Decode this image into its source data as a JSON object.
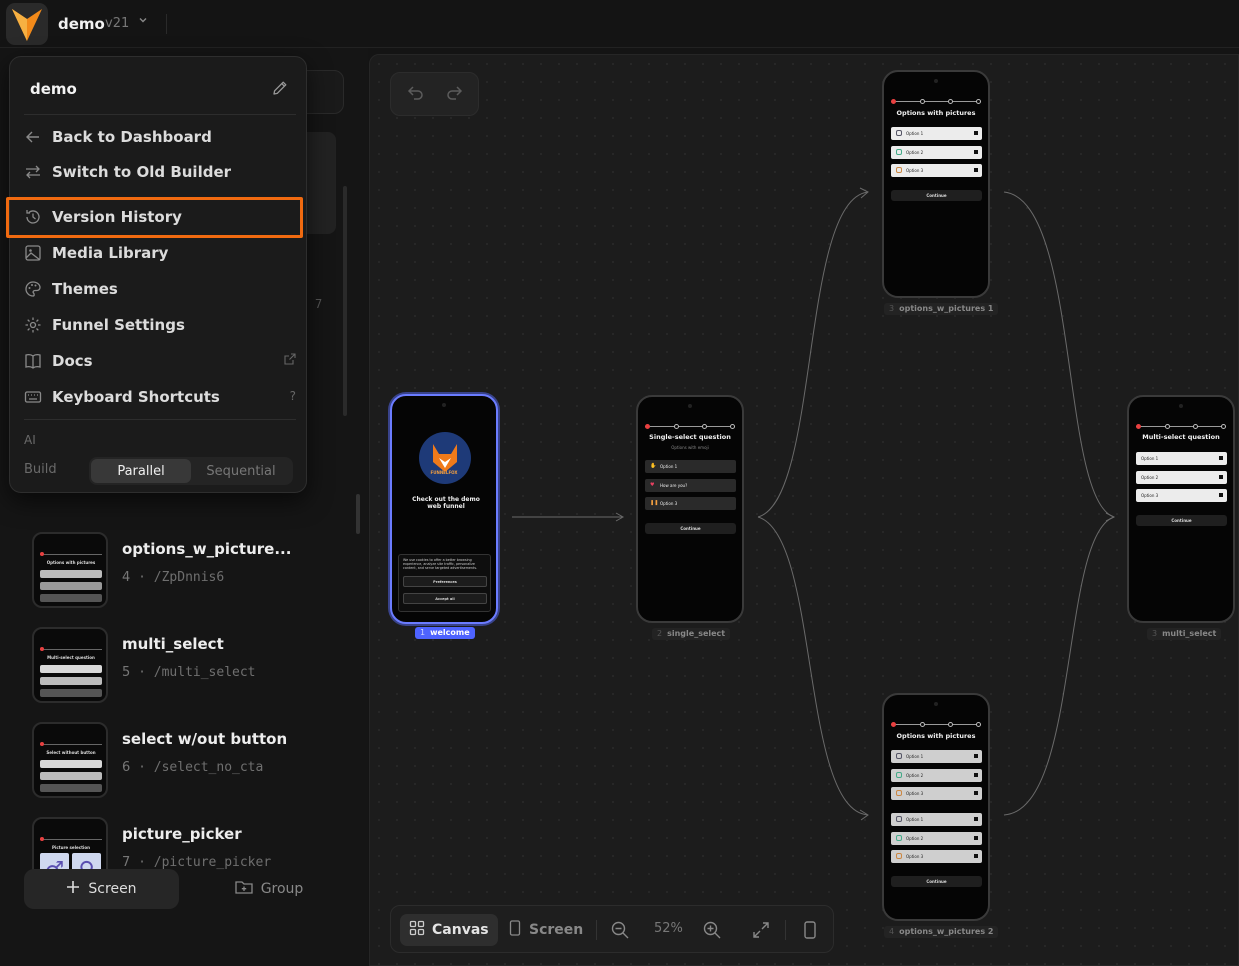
{
  "app": {
    "project_name": "demo",
    "version": "v21",
    "accent": "#f06a10",
    "selection_color": "#4e63ff"
  },
  "menu": {
    "title": "demo",
    "items": [
      {
        "label": "Back to Dashboard",
        "icon": "arrow-left-icon"
      },
      {
        "label": "Switch to Old Builder",
        "icon": "swap-icon"
      },
      {
        "label": "Version History",
        "icon": "history-icon"
      },
      {
        "label": "Media Library",
        "icon": "image-icon"
      },
      {
        "label": "Themes",
        "icon": "palette-icon"
      },
      {
        "label": "Funnel Settings",
        "icon": "gear-icon"
      },
      {
        "label": "Docs",
        "icon": "book-icon"
      },
      {
        "label": "Keyboard Shortcuts",
        "icon": "keyboard-icon",
        "shortcut": "?"
      }
    ],
    "ai_label": "AI",
    "build_label": "Build",
    "build_options": [
      "Parallel",
      "Sequential"
    ],
    "build_selected": "Parallel"
  },
  "sidebar": {
    "hidden_number": "7",
    "screens": [
      {
        "name": "options_w_picture...",
        "number": "4",
        "path": "/ZpDnnis6",
        "thumb_title": "Options with pictures"
      },
      {
        "name": "multi_select",
        "number": "5",
        "path": "/multi_select",
        "thumb_title": "Multi-select question"
      },
      {
        "name": "select w/out button",
        "number": "6",
        "path": "/select_no_cta",
        "thumb_title": "Select without button"
      },
      {
        "name": "picture_picker",
        "number": "7",
        "path": "/picture_picker",
        "thumb_title": "Picture selection"
      }
    ],
    "add_screen_label": "Screen",
    "add_group_label": "Group"
  },
  "canvas": {
    "nodes": [
      {
        "id": "welcome",
        "number": "1",
        "label": "welcome",
        "title": "Check out the demo web funnel",
        "brand": "FUNNELFOX",
        "cookie_text": "We use cookies to offer a better browsing experience, analyze site traffic, personalize content, and serve targeted advertisements.",
        "btn1": "Preferences",
        "btn2": "Accept all"
      },
      {
        "id": "single_select",
        "number": "2",
        "label": "single_select",
        "title": "Single-select question",
        "subtitle": "Options with emoji",
        "options": [
          "Option 1",
          "How are you?",
          "Option 3"
        ],
        "button": "Continue"
      },
      {
        "id": "options_w_pictures_1",
        "number": "3",
        "label": "options_w_pictures 1",
        "title": "Options with pictures",
        "options": [
          "Option 1",
          "Option 2",
          "Option 3"
        ],
        "button": "Continue"
      },
      {
        "id": "multi_select",
        "number": "3",
        "label": "multi_select",
        "title": "Multi-select question",
        "options": [
          "Option 1",
          "Option 2",
          "Option 3"
        ],
        "button": "Continue"
      },
      {
        "id": "options_w_pictures_2",
        "number": "4",
        "label": "options_w_pictures 2",
        "title": "Options with pictures",
        "options": [
          "Option 1",
          "Option 2",
          "Option 3",
          "Option 1",
          "Option 2",
          "Option 3"
        ],
        "button": "Continue"
      }
    ]
  },
  "toolbar": {
    "canvas_label": "Canvas",
    "screen_label": "Screen",
    "zoom": "52%",
    "mode_selected": "Canvas"
  }
}
